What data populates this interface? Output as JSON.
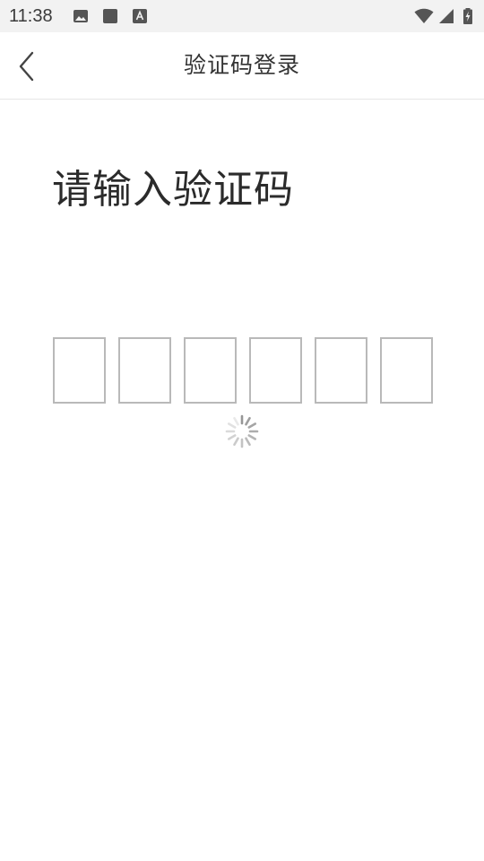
{
  "status_bar": {
    "time": "11:38",
    "left_icons": [
      "image-icon",
      "square-icon",
      "text-a-icon"
    ],
    "right_icons": [
      "wifi-icon",
      "signal-icon",
      "battery-charging-icon"
    ],
    "background": "#f2f2f2"
  },
  "header": {
    "title": "验证码登录",
    "back_icon": "chevron-left-icon"
  },
  "main": {
    "heading": "请输入验证码",
    "code_boxes": [
      "",
      "",
      "",
      "",
      "",
      ""
    ],
    "loading_icon": "spinner-icon"
  },
  "colors": {
    "box_border": "#b9b9b9",
    "text": "#333333",
    "divider": "#e6e6e6"
  }
}
